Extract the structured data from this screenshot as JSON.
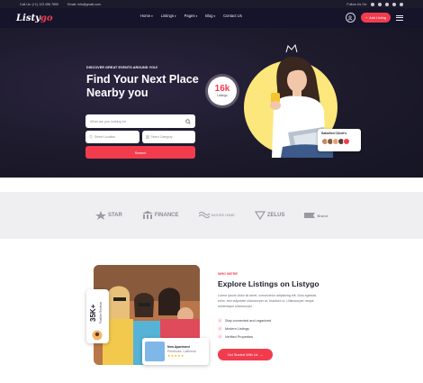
{
  "topbar": {
    "phone": "Call Us: (+1) 123 456 7890",
    "email": "Email: info@gmail.com",
    "follow": "Follow Us On:"
  },
  "header": {
    "logo_text": "Listy",
    "logo_accent": "go",
    "nav": [
      "Home",
      "Listings",
      "Pages",
      "Blog",
      "Contact Us"
    ],
    "add_listing": "Add Listing"
  },
  "hero": {
    "kicker": "DISCOVER GREAT EVENTS AROUND YOU!",
    "title": "Find Your Next Place Nearby you",
    "search_placeholder": "What are you looking for",
    "location_placeholder": "Select Location",
    "category_placeholder": "Select Category",
    "search_button": "Search",
    "badge_number": "16k",
    "badge_label": "Listings",
    "clients_title": "Satisfied Client's"
  },
  "brands": [
    "STAR",
    "FINANCE",
    "NATURE HOME",
    "ZELUS",
    "Brand"
  ],
  "about": {
    "kicker": "WHO WE'RE",
    "title": "Explore Listings on Listygo",
    "description": "Lorem ipsum dolor sit amet, consectetur adipiscing elit. Duis egestas enim, sed vulputate ullamcorper at, tincidunt ut. Ullamcorper neque scelerisque ullamcorper.",
    "features": [
      "Stay connected and organized",
      "Modern Listings",
      "Verified Properties"
    ],
    "cta": "Get Started With Us",
    "stat_number": "35K+",
    "stat_label": "Positive Reviews",
    "listing_title": "New Apartment",
    "listing_location": "Pembroke, California",
    "listing_stars": "★★★★★"
  },
  "colors": {
    "accent": "#f23c4e",
    "dark": "#15142a",
    "yellow": "#fbe77b"
  }
}
